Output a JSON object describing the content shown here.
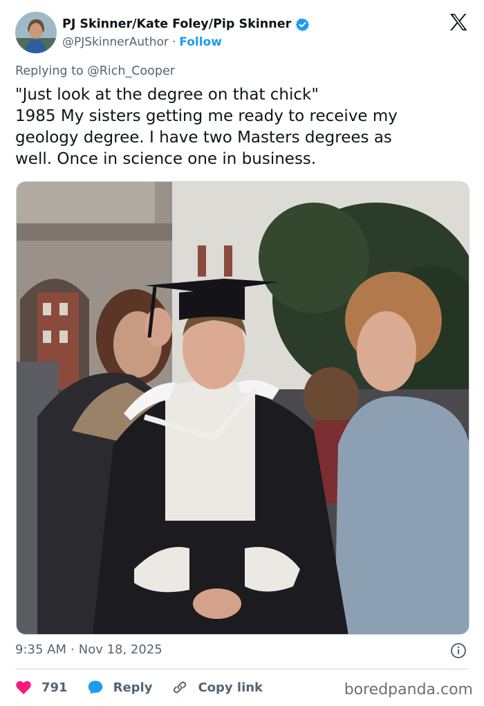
{
  "author": {
    "display_name": "PJ Skinner/Kate Foley/Pip Skinner",
    "handle": "@PJSkinnerAuthor",
    "separator": "·",
    "follow_label": "Follow",
    "verified": true
  },
  "reply": {
    "replying_to": "Replying to @Rich_Cooper"
  },
  "tweet": {
    "lines": [
      "\"Just look at the degree on that chick\"",
      "1985 My sisters getting me ready to receive my",
      "geology degree. I have two Masters degrees as",
      "well. Once in science one in business."
    ]
  },
  "meta": {
    "time": "9:35 AM",
    "separator": "·",
    "date": "Nov 18, 2025"
  },
  "actions": {
    "like_count": "791",
    "reply_label": "Reply",
    "copy_link_label": "Copy link"
  },
  "watermark": "boredpanda.com",
  "icons": {
    "like": "heart-icon",
    "reply": "reply-bubble-icon",
    "copy": "link-icon",
    "info": "info-icon",
    "brand": "x-logo-icon",
    "verified": "verified-badge-icon"
  },
  "colors": {
    "accent": "#1d9bf0",
    "like": "#f91880",
    "text": "#0f1419",
    "secondary": "#536471"
  }
}
